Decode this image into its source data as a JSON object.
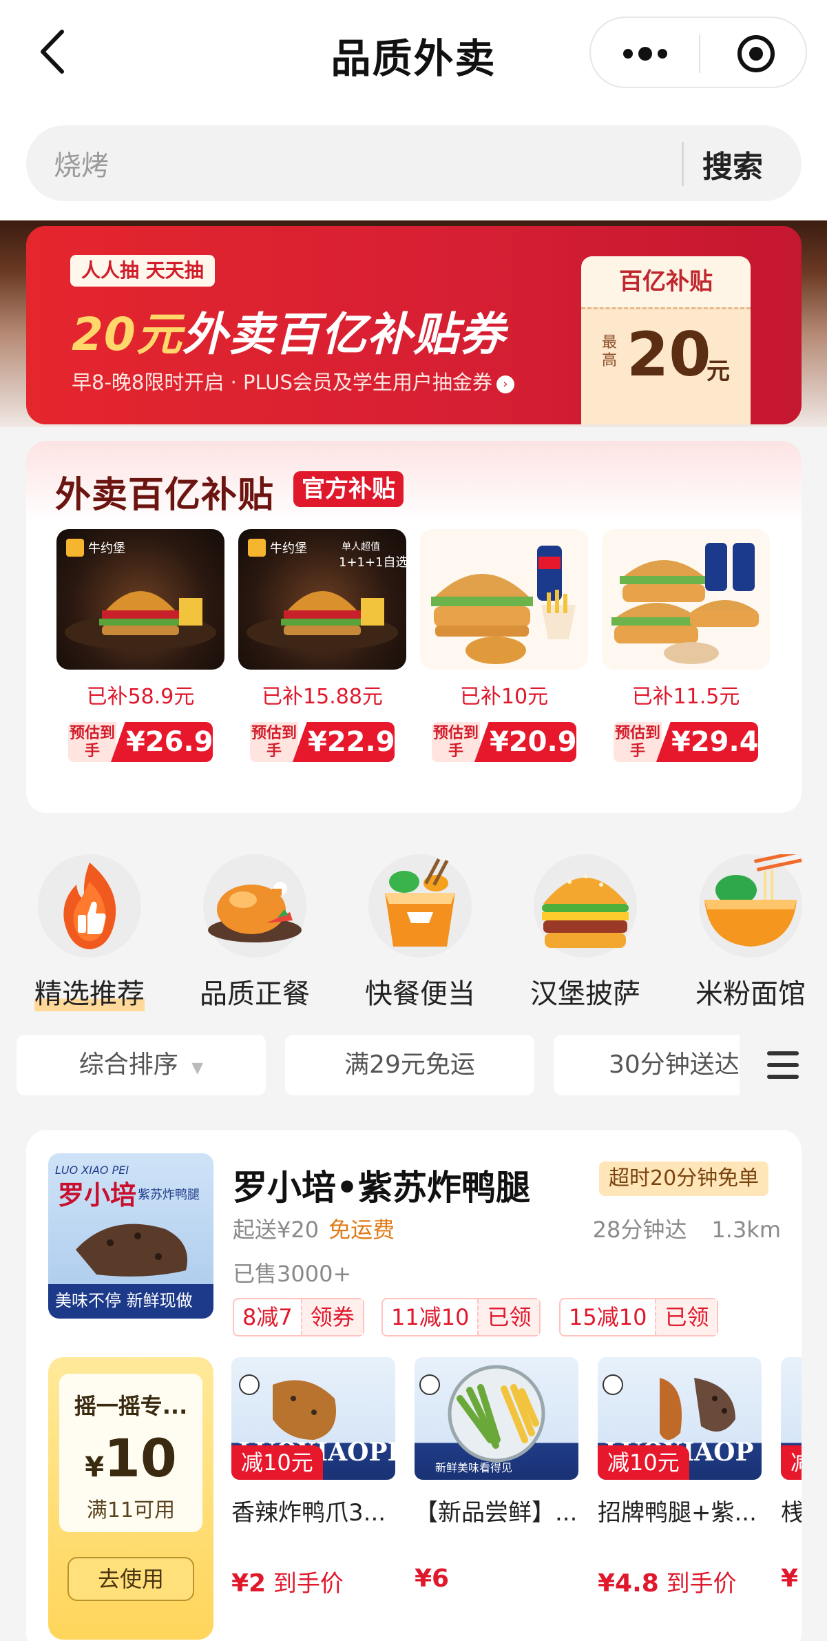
{
  "header": {
    "title": "品质外卖"
  },
  "search": {
    "placeholder": "烧烤",
    "button": "搜索"
  },
  "banner": {
    "tag": "人人抽 天天抽",
    "headline_amount": "20元",
    "headline_text": "外卖百亿补贴券",
    "subtitle": "早8-晚8限时开启 · PLUS会员及学生用户抽金券",
    "coupon_top": "百亿补贴",
    "coupon_prefix": "最高",
    "coupon_value": "20",
    "coupon_unit": "元"
  },
  "subsidy": {
    "title": "外卖百亿补贴",
    "badge": "官方补贴",
    "price_prefix": "预估到手",
    "products": [
      {
        "subsidy": "已补58.9元",
        "price": "¥26.9"
      },
      {
        "subsidy": "已补15.88元",
        "price": "¥22.9"
      },
      {
        "subsidy": "已补10元",
        "price": "¥20.9"
      },
      {
        "subsidy": "已补11.5元",
        "price": "¥29.4"
      }
    ]
  },
  "categories": [
    {
      "label": "精选推荐",
      "icon": "thumbs-up-flame-icon"
    },
    {
      "label": "品质正餐",
      "icon": "roast-chicken-icon"
    },
    {
      "label": "快餐便当",
      "icon": "takeout-box-icon"
    },
    {
      "label": "汉堡披萨",
      "icon": "burger-icon"
    },
    {
      "label": "米粉面馆",
      "icon": "noodle-bowl-icon"
    }
  ],
  "filters": {
    "sort": "综合排序",
    "free_delivery": "满29元免运",
    "fast": "30分钟送达"
  },
  "shop": {
    "name": "罗小培•紫苏炸鸭腿",
    "badge": "超时20分钟免单",
    "min_order": "起送¥20",
    "free_delivery": "免运费",
    "eta": "28分钟达",
    "distance": "1.3km",
    "sold": "已售3000+",
    "coupons": [
      {
        "deal": "8减7",
        "action": "领券"
      },
      {
        "deal": "11减10",
        "action": "已领"
      },
      {
        "deal": "15减10",
        "action": "已领"
      }
    ],
    "shake": {
      "title": "摇一摇专...",
      "amount": "10",
      "condition": "满11可用",
      "button": "去使用"
    },
    "items": [
      {
        "name": "香辣炸鸭爪3...",
        "off": "减10元",
        "price": "¥2",
        "price_note": "到手价"
      },
      {
        "name": "【新品尝鲜】...",
        "off": "",
        "price": "¥6",
        "price_note": ""
      },
      {
        "name": "招牌鸭腿+紫...",
        "off": "减10元",
        "price": "¥4.8",
        "price_note": "到手价"
      },
      {
        "name": "桟",
        "off": "减",
        "price": "¥",
        "price_note": ""
      }
    ]
  },
  "colors": {
    "accent": "#e0182c",
    "gold": "#ffd76b"
  }
}
